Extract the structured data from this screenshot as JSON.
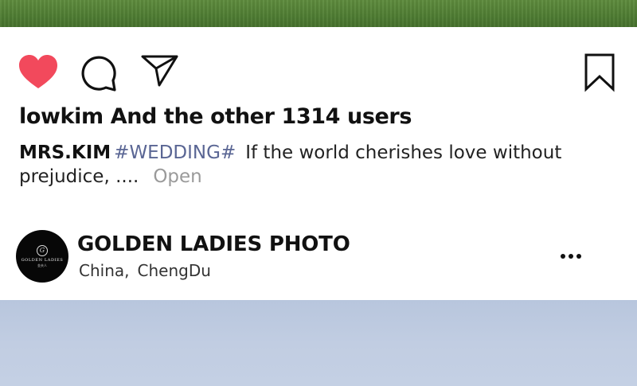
{
  "post": {
    "likes_text": "lowkim And the other 1314 users",
    "caption": {
      "author": "MRS.KIM",
      "hashtag": "#WEDDING#",
      "text_line1": "If the world cherishes love without",
      "text_line2": "prejudice, ....",
      "open_label": "Open"
    }
  },
  "next_post": {
    "account_name": "GOLDEN LADIES PHOTO",
    "location_country": "China,",
    "location_city": "ChengDu",
    "avatar": {
      "logo_mark": "G",
      "logo_text": "GOLDEN LADIES",
      "logo_sub": "金夫人"
    }
  },
  "icons": {
    "like": "heart-icon",
    "comment": "comment-icon",
    "share": "paper-plane-icon",
    "save": "bookmark-icon",
    "more": "more-horizontal-icon"
  },
  "colors": {
    "like_active": "#f2495c",
    "hashtag": "#5a6694",
    "open_link": "#9a9a9a"
  }
}
